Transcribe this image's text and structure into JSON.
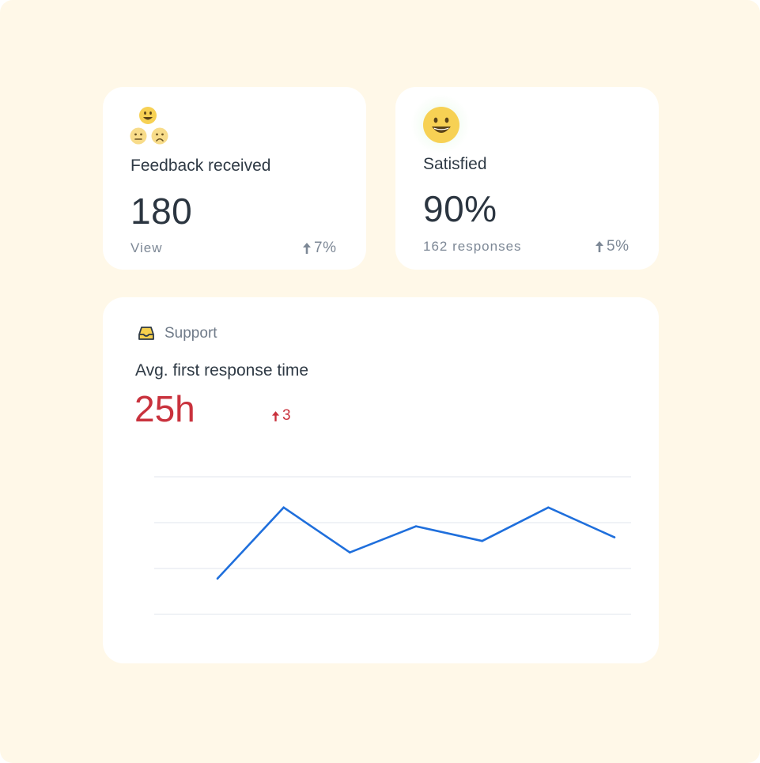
{
  "feedback_card": {
    "title": "Feedback received",
    "value": "180",
    "link_label": "View",
    "trend": "7%",
    "icon": "smiley-faces-group-icon"
  },
  "satisfied_card": {
    "title": "Satisfied",
    "value": "90%",
    "responses": "162 responses",
    "trend": "5%",
    "icon": "happy-face-icon"
  },
  "support_card": {
    "section_label": "Support",
    "section_icon": "inbox-tray-icon",
    "metric_title": "Avg. first response time",
    "metric_value": "25h",
    "metric_delta": "3",
    "accent_color": "#c9323d",
    "line_color": "#1f6fdc"
  },
  "chart_data": {
    "type": "line",
    "title": "",
    "xlabel": "",
    "ylabel": "",
    "grid": true,
    "legend": "none",
    "x": [
      1,
      2,
      3,
      4,
      5,
      6,
      7
    ],
    "ylim": [
      0,
      3
    ],
    "series": [
      {
        "values": [
          0.78,
          2.33,
          1.35,
          1.92,
          1.6,
          2.33,
          1.68
        ]
      }
    ]
  }
}
